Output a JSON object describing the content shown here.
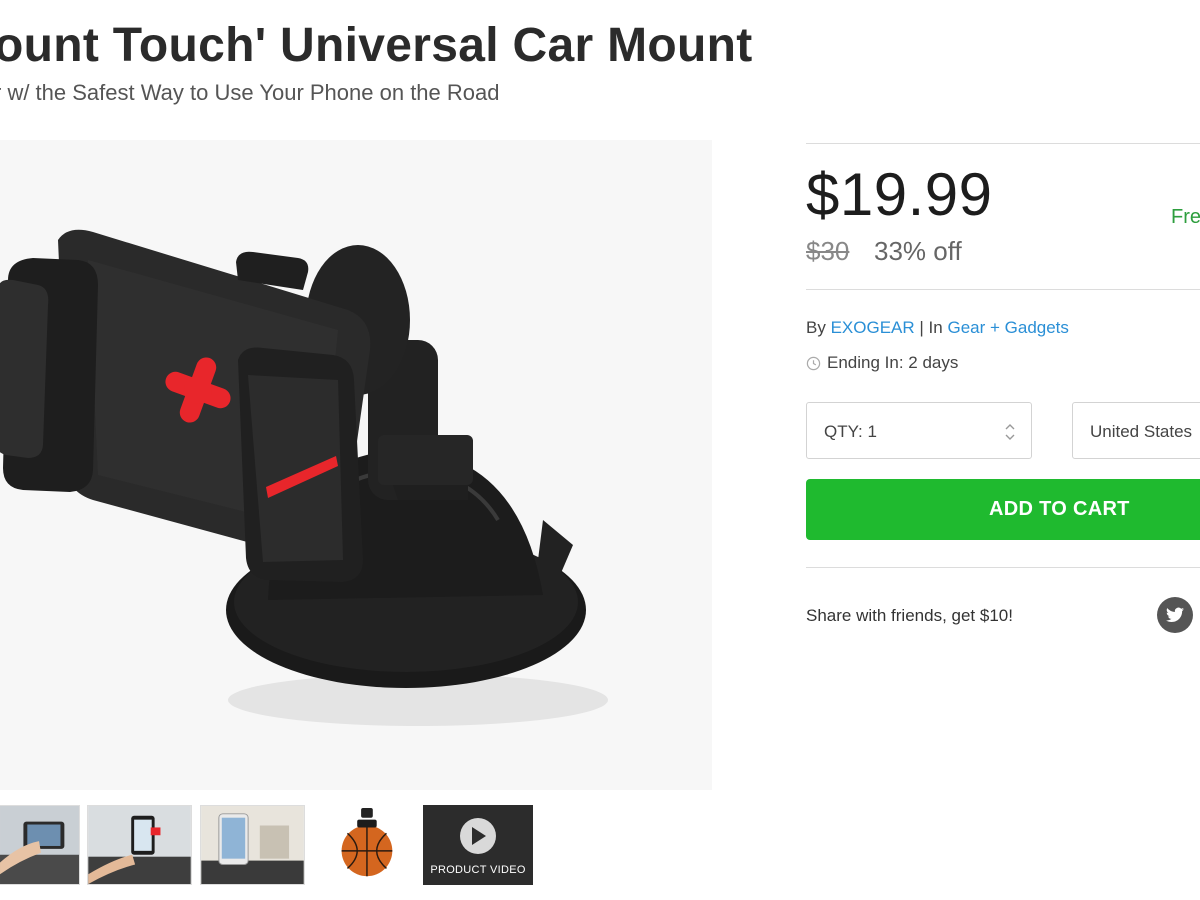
{
  "product": {
    "title": "ount Touch' Universal Car Mount",
    "subtitle": "r w/ the Safest Way to Use Your Phone on the Road"
  },
  "pricing": {
    "price": "$19.99",
    "shipping_badge": "Fre",
    "original_price": "$30",
    "discount": "33% off",
    "price_color": "#1d1d1d",
    "shipping_color": "#2e9e3e"
  },
  "meta": {
    "by_prefix": "By",
    "vendor": "EXOGEAR",
    "separator": "| In",
    "category": "Gear + Gadgets",
    "ending": "Ending In: 2 days",
    "link_color": "#2a8fd6"
  },
  "purchase": {
    "quantity": "QTY: 1",
    "country": "United States",
    "add_to_cart": "ADD TO CART",
    "cart_color": "#1fba2f"
  },
  "share": {
    "text": "Share with friends, get $10!",
    "icon": "twitter-icon"
  },
  "gallery": {
    "video_label": "PRODUCT VIDEO",
    "thumbnails": [
      "car-mount-in-car",
      "phone-in-mount",
      "phone-on-dashboard",
      "basketball-on-mount",
      "product-video"
    ]
  },
  "icons": {
    "clock": "clock-icon",
    "stepper": "updown-chevron-icon",
    "play": "play-icon"
  }
}
